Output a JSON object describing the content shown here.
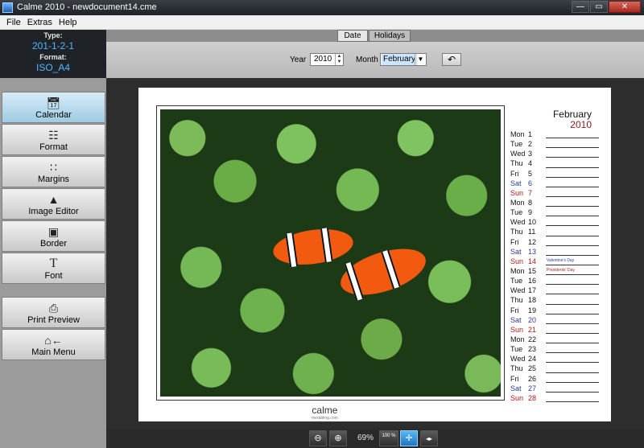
{
  "window": {
    "title": "Calme 2010 - newdocument14.cme",
    "minimize": "—",
    "maximize": "▭",
    "close": "✕"
  },
  "menu": [
    "File",
    "Extras",
    "Help"
  ],
  "info": {
    "type_label": "Type:",
    "type_value": "201-1-2-1",
    "format_label": "Format:",
    "format_value": "ISO_A4"
  },
  "nav": [
    {
      "label": "Calendar",
      "icon": "calendar-icon",
      "active": true
    },
    {
      "label": "Format",
      "icon": "format-icon",
      "active": false
    },
    {
      "label": "Margins",
      "icon": "margins-icon",
      "active": false
    },
    {
      "label": "Image Editor",
      "icon": "person-icon",
      "active": false
    },
    {
      "label": "Border",
      "icon": "border-icon",
      "active": false
    },
    {
      "label": "Font",
      "icon": "font-icon",
      "active": false
    },
    {
      "label": "Print Preview",
      "icon": "printer-icon",
      "active": false
    },
    {
      "label": "Main Menu",
      "icon": "home-back-icon",
      "active": false
    }
  ],
  "tabs": [
    {
      "label": "Date",
      "active": true
    },
    {
      "label": "Holidays",
      "active": false
    }
  ],
  "controls": {
    "year_label": "Year",
    "year_value": "2010",
    "month_label": "Month",
    "month_value": "February"
  },
  "calendar": {
    "month": "February",
    "year": "2010",
    "days": [
      {
        "dn": "Mon",
        "d": "1",
        "type": "wd",
        "note": ""
      },
      {
        "dn": "Tue",
        "d": "2",
        "type": "wd",
        "note": ""
      },
      {
        "dn": "Wed",
        "d": "3",
        "type": "wd",
        "note": ""
      },
      {
        "dn": "Thu",
        "d": "4",
        "type": "wd",
        "note": ""
      },
      {
        "dn": "Fri",
        "d": "5",
        "type": "wd",
        "note": ""
      },
      {
        "dn": "Sat",
        "d": "6",
        "type": "sat",
        "note": ""
      },
      {
        "dn": "Sun",
        "d": "7",
        "type": "sun",
        "note": ""
      },
      {
        "dn": "Mon",
        "d": "8",
        "type": "wd",
        "note": ""
      },
      {
        "dn": "Tue",
        "d": "9",
        "type": "wd",
        "note": ""
      },
      {
        "dn": "Wed",
        "d": "10",
        "type": "wd",
        "note": ""
      },
      {
        "dn": "Thu",
        "d": "11",
        "type": "wd",
        "note": ""
      },
      {
        "dn": "Fri",
        "d": "12",
        "type": "wd",
        "note": ""
      },
      {
        "dn": "Sat",
        "d": "13",
        "type": "sat",
        "note": ""
      },
      {
        "dn": "Sun",
        "d": "14",
        "type": "sun",
        "note": "Valentine's Day",
        "noteColor": "blue"
      },
      {
        "dn": "Mon",
        "d": "15",
        "type": "wd",
        "note": "Presidents' Day",
        "noteColor": "red"
      },
      {
        "dn": "Tue",
        "d": "16",
        "type": "wd",
        "note": ""
      },
      {
        "dn": "Wed",
        "d": "17",
        "type": "wd",
        "note": ""
      },
      {
        "dn": "Thu",
        "d": "18",
        "type": "wd",
        "note": ""
      },
      {
        "dn": "Fri",
        "d": "19",
        "type": "wd",
        "note": ""
      },
      {
        "dn": "Sat",
        "d": "20",
        "type": "sat",
        "note": ""
      },
      {
        "dn": "Sun",
        "d": "21",
        "type": "sun",
        "note": ""
      },
      {
        "dn": "Mon",
        "d": "22",
        "type": "wd",
        "note": ""
      },
      {
        "dn": "Tue",
        "d": "23",
        "type": "wd",
        "note": ""
      },
      {
        "dn": "Wed",
        "d": "24",
        "type": "wd",
        "note": ""
      },
      {
        "dn": "Thu",
        "d": "25",
        "type": "wd",
        "note": ""
      },
      {
        "dn": "Fri",
        "d": "26",
        "type": "wd",
        "note": ""
      },
      {
        "dn": "Sat",
        "d": "27",
        "type": "sat",
        "note": ""
      },
      {
        "dn": "Sun",
        "d": "28",
        "type": "sun",
        "note": ""
      }
    ]
  },
  "logo": {
    "text": "calme",
    "sub": "merabling.com"
  },
  "zoom": {
    "value": "69%",
    "hundred": "100 %"
  }
}
